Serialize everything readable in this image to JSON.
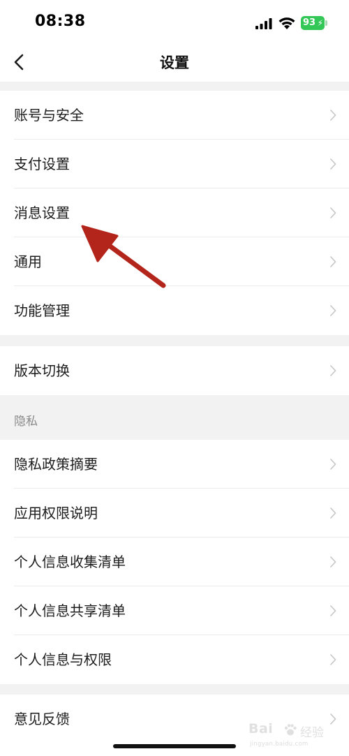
{
  "status_bar": {
    "time": "08:38",
    "battery_level": "93",
    "battery_color": "#33c758"
  },
  "nav": {
    "title": "设置",
    "back_icon": "chevron-left-icon"
  },
  "group1": {
    "items": [
      {
        "label": "账号与安全"
      },
      {
        "label": "支付设置"
      },
      {
        "label": "消息设置"
      },
      {
        "label": "通用"
      },
      {
        "label": "功能管理"
      }
    ]
  },
  "group2": {
    "items": [
      {
        "label": "版本切换"
      }
    ]
  },
  "privacy": {
    "header": "隐私",
    "items": [
      {
        "label": "隐私政策摘要"
      },
      {
        "label": "应用权限说明"
      },
      {
        "label": "个人信息收集清单"
      },
      {
        "label": "个人信息共享清单"
      },
      {
        "label": "个人信息与权限"
      }
    ]
  },
  "group4": {
    "items": [
      {
        "label": "意见反馈"
      }
    ]
  },
  "annotation": {
    "arrow_color": "#b3241b",
    "points_to": "消息设置"
  },
  "watermark": {
    "logo": "Bai",
    "brand": "经验",
    "url": "jingyan.baidu.com"
  }
}
